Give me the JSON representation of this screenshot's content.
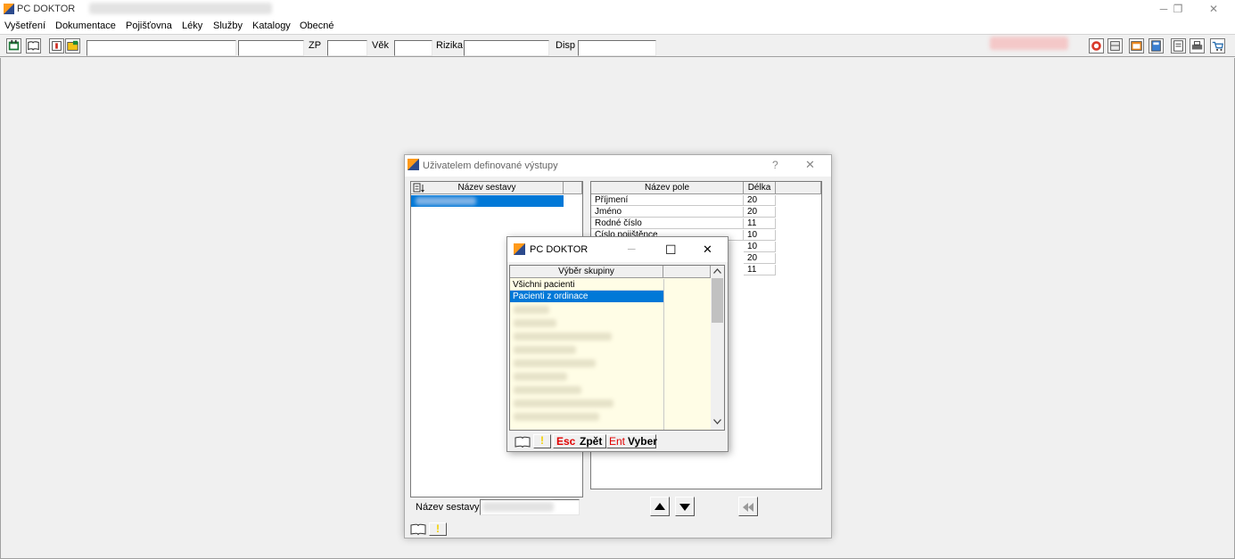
{
  "window": {
    "title": "PC DOKTOR",
    "controls": {
      "minimize": "─",
      "restore": "❐",
      "close": "✕"
    }
  },
  "menu": [
    "Vyšetření",
    "Dokumentace",
    "Pojišťovna",
    "Léky",
    "Služby",
    "Katalogy",
    "Obecné"
  ],
  "toolbar": {
    "zp_label": "ZP",
    "vek_label": "Věk",
    "rizika_label": "Rizika",
    "disp_label": "Disp",
    "left_icons": [
      "calendar-icon",
      "book-icon",
      "card-icon",
      "folder-icon"
    ],
    "right_icons": [
      "lifebuoy-icon",
      "cabinet-icon",
      "window-icon",
      "calculator-icon",
      "document-icon",
      "printer-icon",
      "cart-icon"
    ]
  },
  "dialog": {
    "title": "Uživatelem definované výstupy",
    "help": "?",
    "close": "✕",
    "report_list": {
      "header": "Název sestavy"
    },
    "fields_table": {
      "headers": [
        "Název pole",
        "Délka"
      ],
      "rows": [
        {
          "name": "Příjmení",
          "length": "20"
        },
        {
          "name": "Jméno",
          "length": "20"
        },
        {
          "name": "Rodné číslo",
          "length": "11"
        },
        {
          "name": "Číslo pojištěnce",
          "length": "10"
        },
        {
          "name": "",
          "length": "10"
        },
        {
          "name": "",
          "length": "20"
        },
        {
          "name": "",
          "length": "11"
        }
      ]
    },
    "report_name_label": "Název sestavy:"
  },
  "popup": {
    "title": "PC DOKTOR",
    "controls": {
      "minimize": "─",
      "maximize": "☐",
      "close": "✕"
    },
    "list_header": "Výběr skupiny",
    "items": [
      "Všichni pacienti",
      "Pacienti z ordinace"
    ],
    "selected_index": 1,
    "esc_key": "Esc",
    "esc_label": "Zpět",
    "ent_key": "Ent",
    "ent_label": "Vyber"
  },
  "colors": {
    "selection": "#0078d7",
    "list_background": "#fffde6",
    "key_red": "#e00000"
  }
}
